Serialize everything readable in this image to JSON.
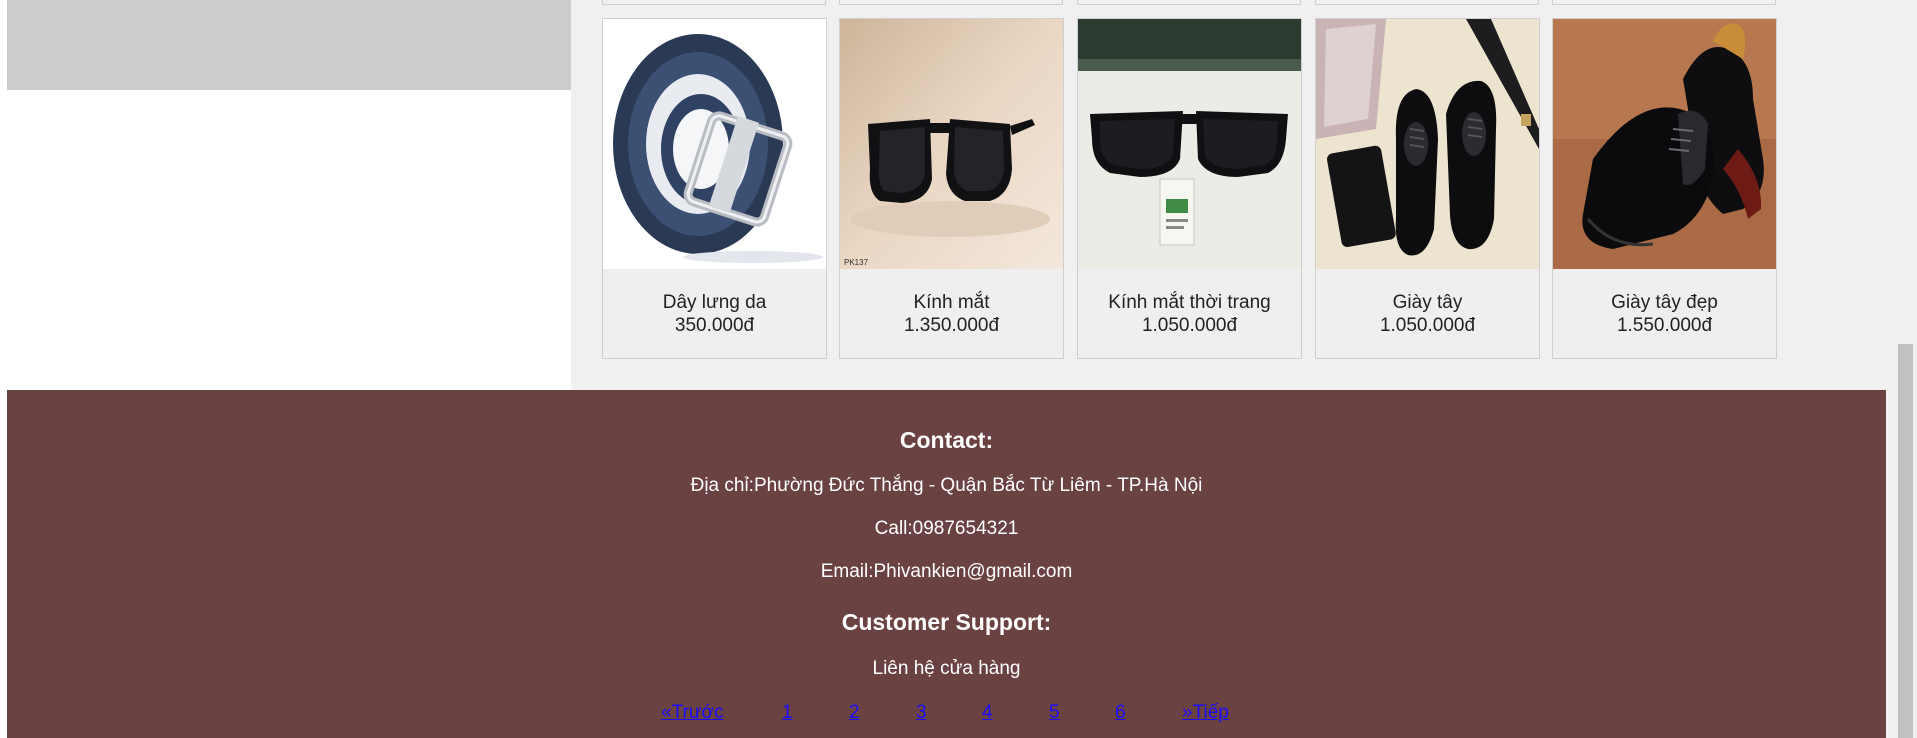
{
  "products": [
    {
      "name": "Dây lưng da",
      "price": "350.000đ",
      "image": "belt"
    },
    {
      "name": "Kính mắt",
      "price": "1.350.000đ",
      "image": "sunglasses"
    },
    {
      "name": "Kính mắt thời trang",
      "price": "1.050.000đ",
      "image": "sunglasses-tag"
    },
    {
      "name": "Giày tây",
      "price": "1.050.000đ",
      "image": "oxford-shoes-wallet"
    },
    {
      "name": "Giày tây đẹp",
      "price": "1.550.000đ",
      "image": "oxford-shoes"
    }
  ],
  "footer": {
    "contact_heading": "Contact:",
    "address": "Địa chỉ:Phường Đức Thắng - Quận Bắc Từ Liêm - TP.Hà Nội",
    "call": "Call:0987654321",
    "email": "Email:Phivankien@gmail.com",
    "support_heading": "Customer Support:",
    "support_text": "Liên hệ cửa hàng"
  },
  "pagination": {
    "prev": "«Trước",
    "pages": [
      "1",
      "2",
      "3",
      "4",
      "5",
      "6"
    ],
    "next": "»Tiếp"
  },
  "image_badge": "PK137",
  "colors": {
    "footer_bg": "#6b4242",
    "link": "#1a0dff",
    "panel": "#cccccc"
  }
}
